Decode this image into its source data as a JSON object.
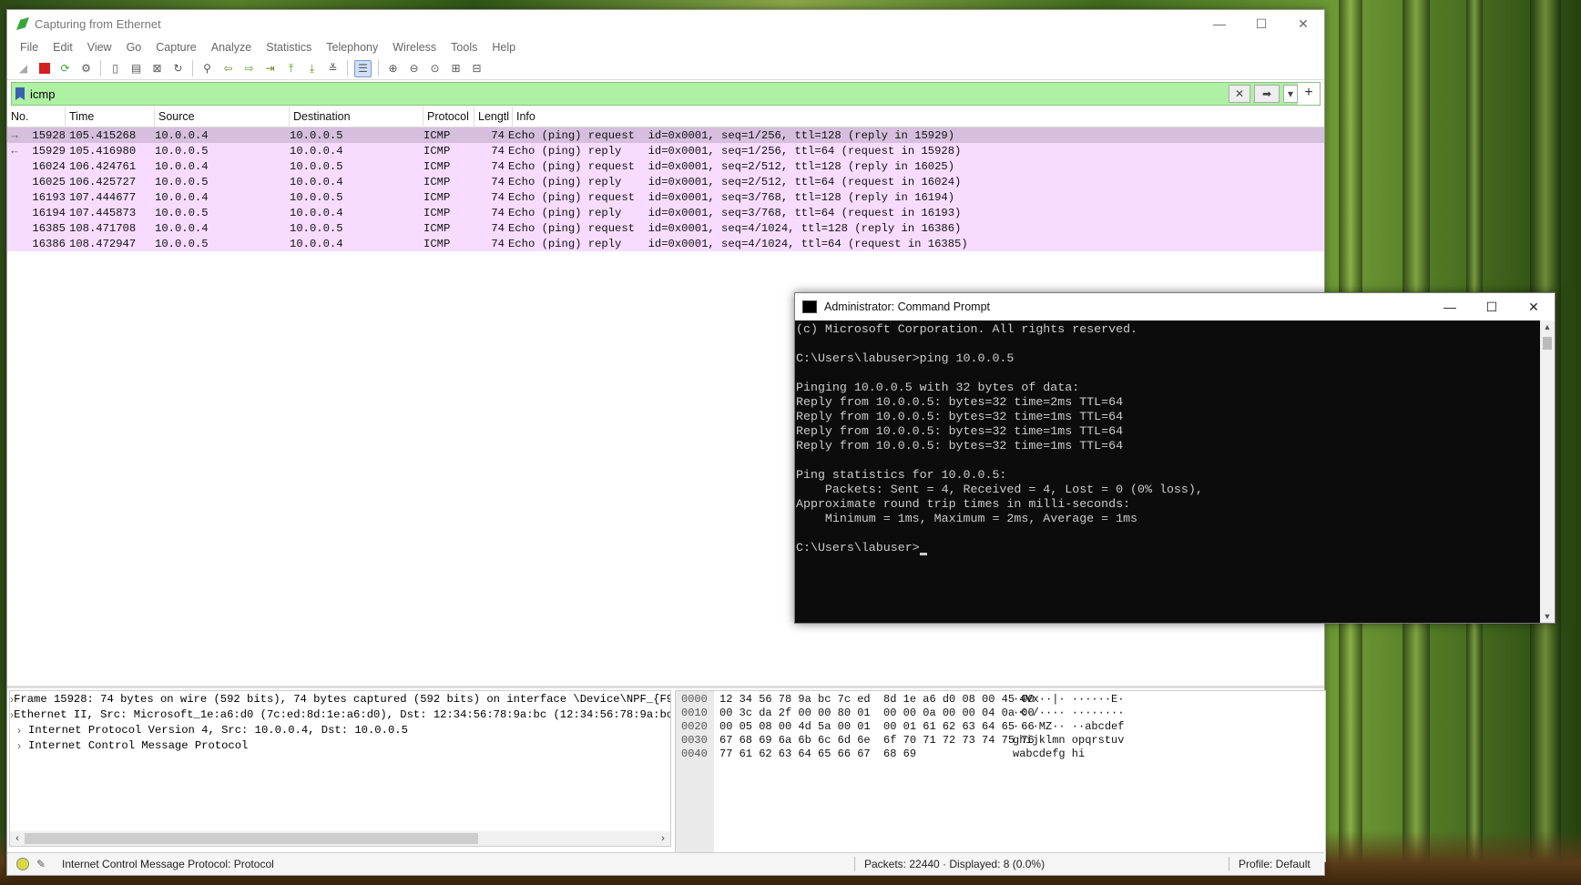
{
  "wireshark": {
    "title": "Capturing from Ethernet",
    "menu": [
      "File",
      "Edit",
      "View",
      "Go",
      "Capture",
      "Analyze",
      "Statistics",
      "Telephony",
      "Wireless",
      "Tools",
      "Help"
    ],
    "filter": {
      "value": "icmp"
    },
    "columns": {
      "no": "No.",
      "time": "Time",
      "source": "Source",
      "destination": "Destination",
      "protocol": "Protocol",
      "length": "Lengtl",
      "info": "Info"
    },
    "packets": [
      {
        "mark": "→",
        "no": "15928",
        "time": "105.415268",
        "src": "10.0.0.4",
        "dst": "10.0.0.5",
        "proto": "ICMP",
        "len": "74",
        "info": "Echo (ping) request  id=0x0001, seq=1/256, ttl=128 (reply in 15929)"
      },
      {
        "mark": "←",
        "no": "15929",
        "time": "105.416980",
        "src": "10.0.0.5",
        "dst": "10.0.0.4",
        "proto": "ICMP",
        "len": "74",
        "info": "Echo (ping) reply    id=0x0001, seq=1/256, ttl=64 (request in 15928)"
      },
      {
        "mark": "",
        "no": "16024",
        "time": "106.424761",
        "src": "10.0.0.4",
        "dst": "10.0.0.5",
        "proto": "ICMP",
        "len": "74",
        "info": "Echo (ping) request  id=0x0001, seq=2/512, ttl=128 (reply in 16025)"
      },
      {
        "mark": "",
        "no": "16025",
        "time": "106.425727",
        "src": "10.0.0.5",
        "dst": "10.0.0.4",
        "proto": "ICMP",
        "len": "74",
        "info": "Echo (ping) reply    id=0x0001, seq=2/512, ttl=64 (request in 16024)"
      },
      {
        "mark": "",
        "no": "16193",
        "time": "107.444677",
        "src": "10.0.0.4",
        "dst": "10.0.0.5",
        "proto": "ICMP",
        "len": "74",
        "info": "Echo (ping) request  id=0x0001, seq=3/768, ttl=128 (reply in 16194)"
      },
      {
        "mark": "",
        "no": "16194",
        "time": "107.445873",
        "src": "10.0.0.5",
        "dst": "10.0.0.4",
        "proto": "ICMP",
        "len": "74",
        "info": "Echo (ping) reply    id=0x0001, seq=3/768, ttl=64 (request in 16193)"
      },
      {
        "mark": "",
        "no": "16385",
        "time": "108.471708",
        "src": "10.0.0.4",
        "dst": "10.0.0.5",
        "proto": "ICMP",
        "len": "74",
        "info": "Echo (ping) request  id=0x0001, seq=4/1024, ttl=128 (reply in 16386)"
      },
      {
        "mark": "",
        "no": "16386",
        "time": "108.472947",
        "src": "10.0.0.5",
        "dst": "10.0.0.4",
        "proto": "ICMP",
        "len": "74",
        "info": "Echo (ping) reply    id=0x0001, seq=4/1024, ttl=64 (request in 16385)"
      }
    ],
    "details": [
      "Frame 15928: 74 bytes on wire (592 bits), 74 bytes captured (592 bits) on interface \\Device\\NPF_{F9",
      "Ethernet II, Src: Microsoft_1e:a6:d0 (7c:ed:8d:1e:a6:d0), Dst: 12:34:56:78:9a:bc (12:34:56:78:9a:bc",
      "Internet Protocol Version 4, Src: 10.0.0.4, Dst: 10.0.0.5",
      "Internet Control Message Protocol"
    ],
    "hex": [
      {
        "off": "0000",
        "bytes": "12 34 56 78 9a bc 7c ed  8d 1e a6 d0 08 00 45 00",
        "ascii": "·4Vx··|· ······E·"
      },
      {
        "off": "0010",
        "bytes": "00 3c da 2f 00 00 80 01  00 00 0a 00 00 04 0a 00",
        "ascii": "·<·/···· ········"
      },
      {
        "off": "0020",
        "bytes": "00 05 08 00 4d 5a 00 01  00 01 61 62 63 64 65 66",
        "ascii": "····MZ·· ··abcdef"
      },
      {
        "off": "0030",
        "bytes": "67 68 69 6a 6b 6c 6d 6e  6f 70 71 72 73 74 75 76",
        "ascii": "ghijklmn opqrstuv"
      },
      {
        "off": "0040",
        "bytes": "77 61 62 63 64 65 66 67  68 69",
        "ascii": "wabcdefg hi"
      }
    ],
    "status": {
      "protocol": "Internet Control Message Protocol: Protocol",
      "packets": "Packets: 22440 · Displayed: 8 (0.0%)",
      "profile": "Profile: Default"
    },
    "colors": {
      "filter_ok": "#aef1a3",
      "icmp_row": "#f8dcff",
      "selected_row": "#d6bfdd"
    }
  },
  "cmd": {
    "title": "Administrator: Command Prompt",
    "lines": [
      "(c) Microsoft Corporation. All rights reserved.",
      "",
      "C:\\Users\\labuser>ping 10.0.0.5",
      "",
      "Pinging 10.0.0.5 with 32 bytes of data:",
      "Reply from 10.0.0.5: bytes=32 time=2ms TTL=64",
      "Reply from 10.0.0.5: bytes=32 time=1ms TTL=64",
      "Reply from 10.0.0.5: bytes=32 time=1ms TTL=64",
      "Reply from 10.0.0.5: bytes=32 time=1ms TTL=64",
      "",
      "Ping statistics for 10.0.0.5:",
      "    Packets: Sent = 4, Received = 4, Lost = 0 (0% loss),",
      "Approximate round trip times in milli-seconds:",
      "    Minimum = 1ms, Maximum = 2ms, Average = 1ms",
      ""
    ],
    "prompt": "C:\\Users\\labuser>"
  }
}
